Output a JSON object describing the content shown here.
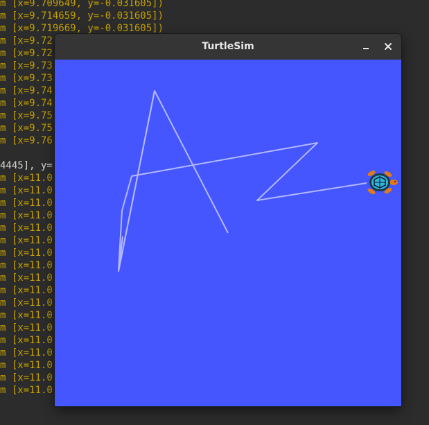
{
  "terminal": {
    "lines": [
      {
        "text": "m [x=9.709649, y=-0.031605])",
        "plain": false
      },
      {
        "text": "m [x=9.714659, y=-0.031605])",
        "plain": false
      },
      {
        "text": "m [x=9.719669, y=-0.031605])",
        "plain": false
      },
      {
        "text": "m [x=9.72",
        "plain": false
      },
      {
        "text": "m [x=9.72",
        "plain": false
      },
      {
        "text": "m [x=9.73",
        "plain": false
      },
      {
        "text": "m [x=9.73",
        "plain": false
      },
      {
        "text": "m [x=9.74",
        "plain": false
      },
      {
        "text": "m [x=9.74",
        "plain": false
      },
      {
        "text": "m [x=9.75",
        "plain": false
      },
      {
        "text": "m [x=9.75",
        "plain": false
      },
      {
        "text": "m [x=9.76",
        "plain": false
      },
      {
        "text": "",
        "plain": true
      },
      {
        "text": "4445], y=",
        "plain": true
      },
      {
        "text": "m [x=11.0",
        "plain": false
      },
      {
        "text": "m [x=11.0",
        "plain": false
      },
      {
        "text": "m [x=11.0",
        "plain": false
      },
      {
        "text": "m [x=11.0",
        "plain": false
      },
      {
        "text": "m [x=11.0",
        "plain": false
      },
      {
        "text": "m [x=11.0",
        "plain": false
      },
      {
        "text": "m [x=11.0",
        "plain": false
      },
      {
        "text": "m [x=11.0",
        "plain": false
      },
      {
        "text": "m [x=11.0",
        "plain": false
      },
      {
        "text": "m [x=11.0",
        "plain": false
      },
      {
        "text": "m [x=11.0",
        "plain": false
      },
      {
        "text": "m [x=11.0",
        "plain": false
      },
      {
        "text": "m [x=11.0",
        "plain": false
      },
      {
        "text": "m [x=11.0",
        "plain": false
      },
      {
        "text": "m [x=11.0",
        "plain": false
      },
      {
        "text": "m [x=11.0",
        "plain": false
      },
      {
        "text": "m [x=11.0",
        "plain": false
      },
      {
        "text": "m [x=11.0",
        "plain": false
      }
    ]
  },
  "window": {
    "title": "TurtleSim",
    "minimize_icon": "minimize-icon",
    "close_icon": "close-icon"
  },
  "sim": {
    "background_color": "#4556ff",
    "pen_color": "#b3b8ff",
    "turtle_icon": "turtle-icon"
  }
}
